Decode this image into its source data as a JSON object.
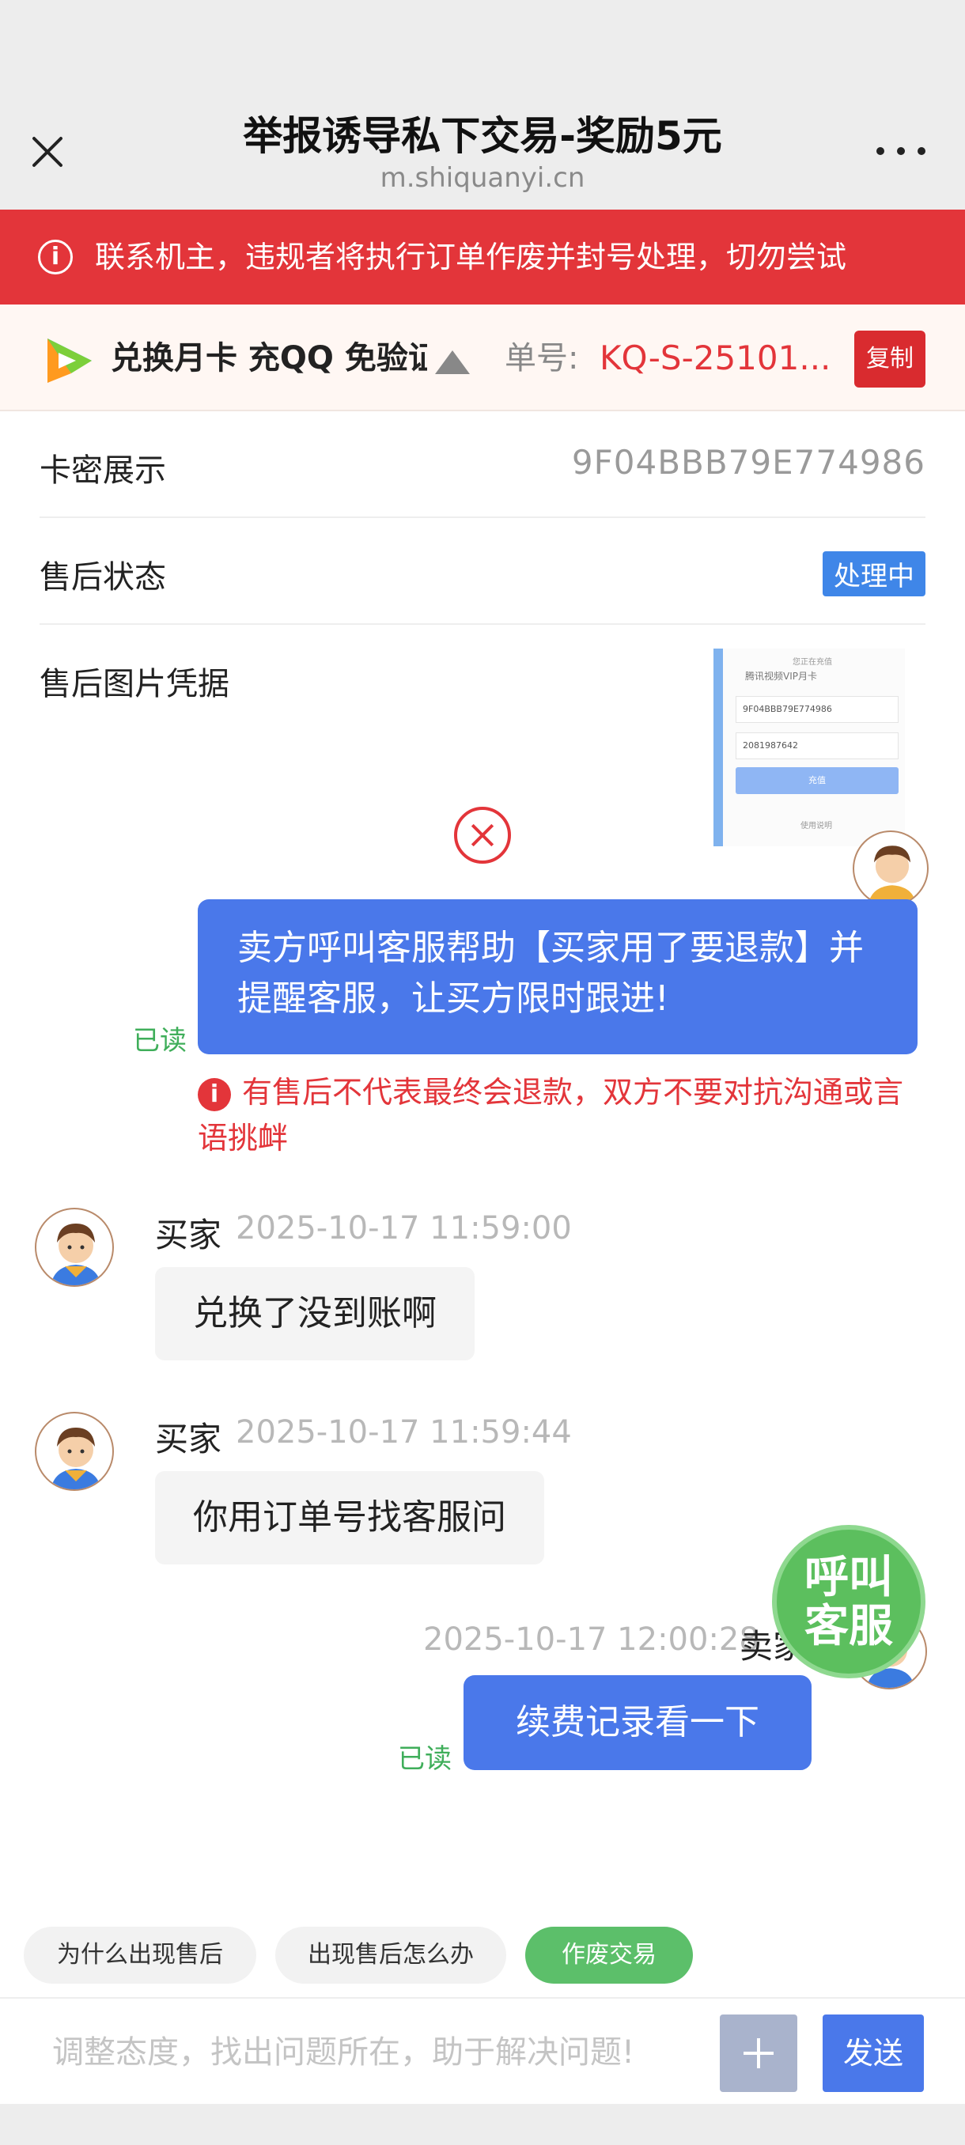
{
  "header": {
    "title": "举报诱导私下交易-奖励5元",
    "url": "m.shiquanyi.cn"
  },
  "notice": {
    "text": "联系机主，违规者将执行订单作废并封号处理，切勿尝试"
  },
  "product": {
    "name": "兑换月卡 充QQ 免验证",
    "order_label": "单号:",
    "order_number": "KQ-S-25101...",
    "copy_label": "复制"
  },
  "info": {
    "card_label": "卡密展示",
    "card_value": "9F04BBB79E774986",
    "status_label": "售后状态",
    "status_value": "处理中",
    "proof_label": "售后图片凭据",
    "proof_thumb": {
      "title": "您正在充值",
      "subtitle": "腾讯视频VIP月卡",
      "field1": "9F04BBB79E774986",
      "field2": "2081987642",
      "button": "充值",
      "footer": "使用说明"
    }
  },
  "chat": {
    "system_message": "卖方呼叫客服帮助【买家用了要退款】并提醒客服，让买方限时跟进!",
    "read_label": "已读",
    "warning": "有售后不代表最终会退款，双方不要对抗沟通或言语挑衅",
    "messages": [
      {
        "sender": "买家",
        "time": "2025-10-17 11:59:00",
        "text": "兑换了没到账啊"
      },
      {
        "sender": "买家",
        "time": "2025-10-17 11:59:44",
        "text": "你用订单号找客服问"
      },
      {
        "sender": "卖家",
        "time": "2025-10-17 12:00:28",
        "text": "续费记录看一下"
      }
    ]
  },
  "call_service": {
    "line1": "呼叫",
    "line2": "客服"
  },
  "quick_replies": [
    "为什么出现售后",
    "出现售后怎么办",
    "作废交易"
  ],
  "input": {
    "placeholder": "调整态度，找出问题所在，助于解决问题!",
    "send_label": "发送"
  },
  "colors": {
    "accent_blue": "#4a78ea",
    "alert_red": "#e3353a",
    "read_green": "#3fae5a",
    "call_green": "#5cbf5e"
  }
}
